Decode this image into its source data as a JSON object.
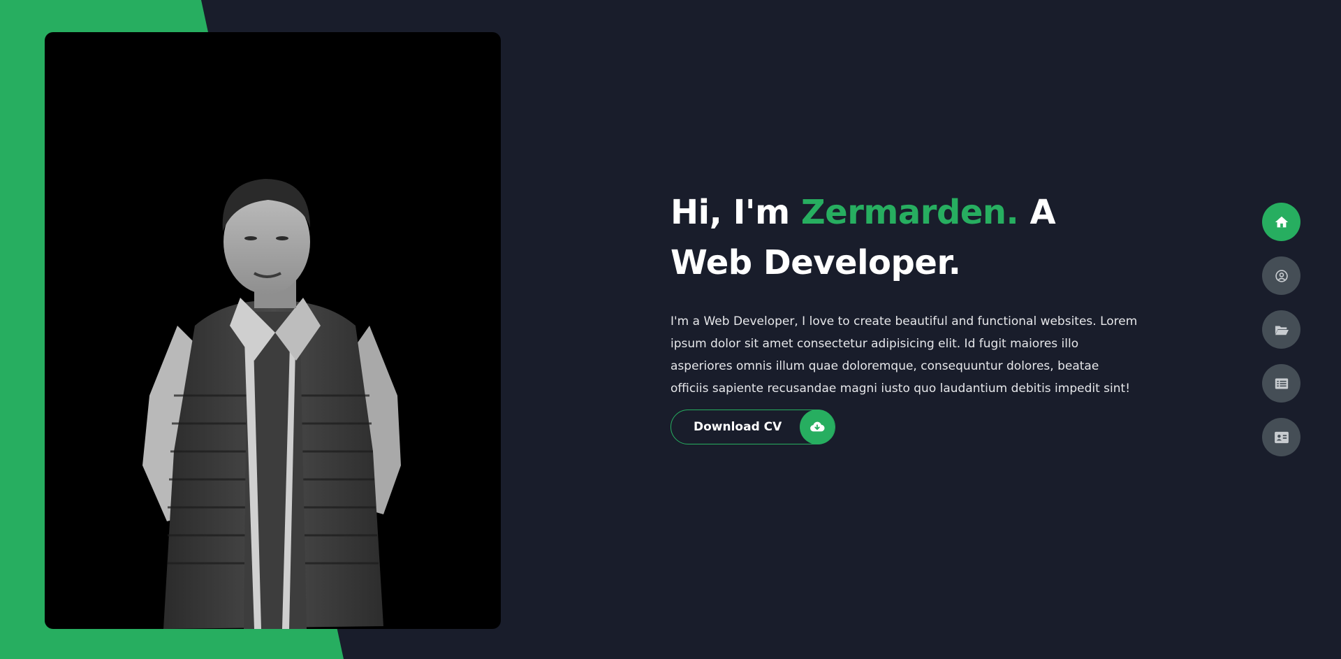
{
  "hero": {
    "title_prefix": "Hi, I'm ",
    "name": "Zermarden.",
    "title_suffix": " A Web Developer.",
    "description": "I'm a Web Developer, I love to create beautiful and functional websites. Lorem ipsum dolor sit amet consectetur adipisicing elit. Id fugit maiores illo asperiores omnis illum quae doloremque, consequuntur dolores, beatae officiis sapiente recusandae magni iusto quo laudantium debitis impedit sint!",
    "cta_label": "Download CV",
    "cta_icon": "cloud-download-icon"
  },
  "nav": [
    {
      "icon": "home-icon",
      "active": true
    },
    {
      "icon": "user-circle-icon",
      "active": false
    },
    {
      "icon": "folder-open-icon",
      "active": false
    },
    {
      "icon": "list-alt-icon",
      "active": false
    },
    {
      "icon": "id-card-icon",
      "active": false
    }
  ],
  "colors": {
    "background": "#191d2b",
    "accent": "#27ae60",
    "nav_inactive": "#454e56",
    "text": "#ffffff"
  }
}
